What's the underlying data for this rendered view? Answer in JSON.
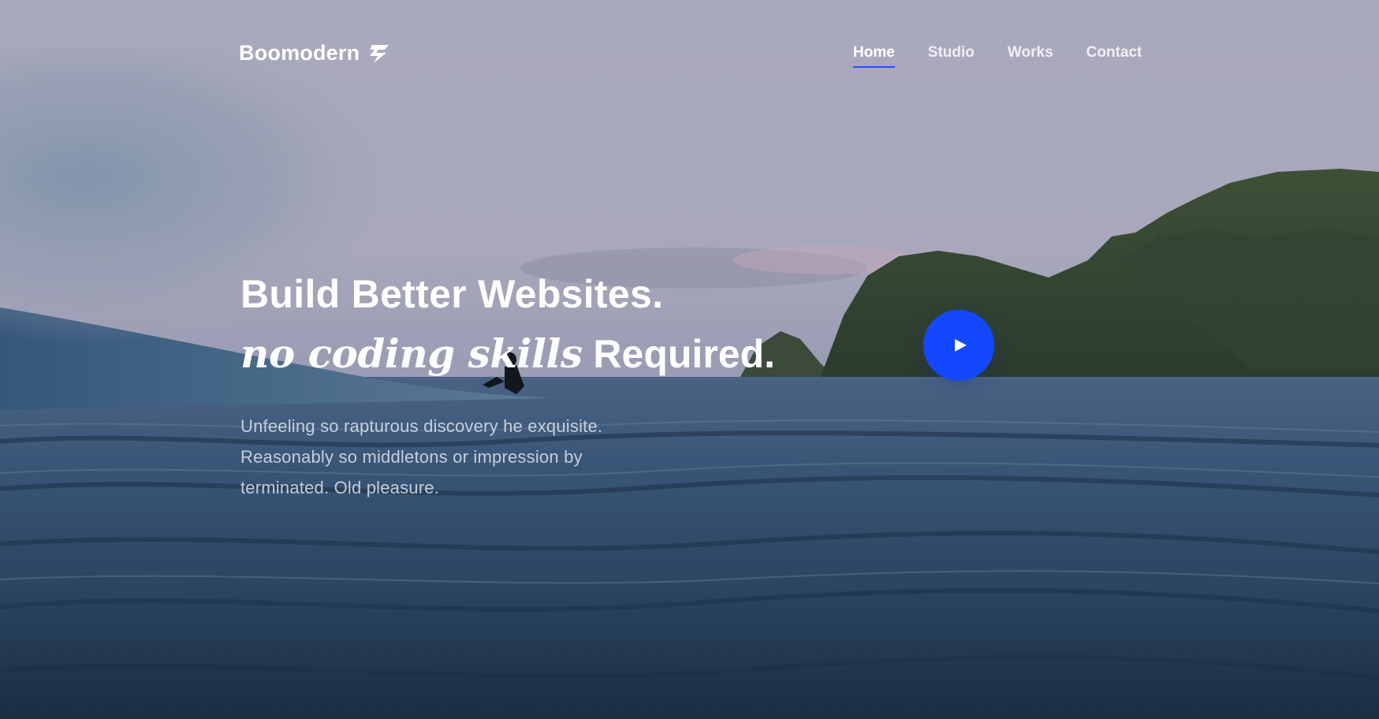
{
  "brand": {
    "name": "Boomodern",
    "icon": "lightning-bolt-icon"
  },
  "nav": {
    "items": [
      {
        "label": "Home",
        "active": true
      },
      {
        "label": "Studio",
        "active": false
      },
      {
        "label": "Works",
        "active": false
      },
      {
        "label": "Contact",
        "active": false
      }
    ]
  },
  "hero": {
    "headline_line1": "Build Better Websites.",
    "headline_italic": "no coding skills",
    "headline_line2_rest": "Required.",
    "subtext": "Unfeeling so rapturous discovery he exquisite. Reasonably so middletons or impression by terminated. Old pleasure.",
    "play_icon": "play-icon"
  },
  "colors": {
    "accent": "#1448ff",
    "nav_underline": "#1f4fff",
    "text": "#ffffff"
  }
}
